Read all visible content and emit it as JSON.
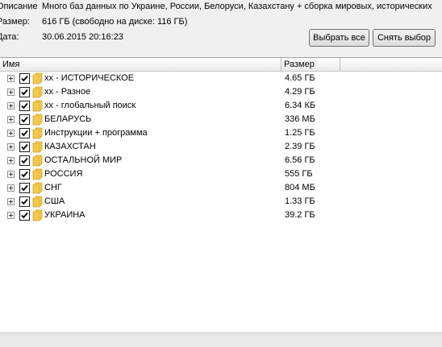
{
  "info": {
    "description_label": "Описание",
    "description_value": "Много баз данных по Украине, России, Белоруси, Казахстану + сборка мировых, исторических",
    "size_label": "Размер:",
    "size_value": "616 ГБ (свободно на диске: 116 ГБ)",
    "date_label": "Дата:",
    "date_value": "30.06.2015 20:16:23"
  },
  "buttons": {
    "select_all": "Выбрать все",
    "deselect": "Снять выбор"
  },
  "columns": {
    "name": "Имя",
    "size": "Размер"
  },
  "colors": {
    "folder": "#f2c94c",
    "check": "#000000"
  },
  "rows": [
    {
      "name": "хх - ИСТОРИЧЕСКОЕ",
      "size": "4.65 ГБ",
      "checked": true
    },
    {
      "name": "хх - Разное",
      "size": "4.29 ГБ",
      "checked": true
    },
    {
      "name": "хх - глобальный поиск",
      "size": "6.34 КБ",
      "checked": true
    },
    {
      "name": "БЕЛАРУСЬ",
      "size": "336 МБ",
      "checked": true
    },
    {
      "name": "Инструкции + программа",
      "size": "1.25 ГБ",
      "checked": true
    },
    {
      "name": "КАЗАХСТАН",
      "size": "2.39 ГБ",
      "checked": true
    },
    {
      "name": "ОСТАЛЬНОЙ МИР",
      "size": "6.56 ГБ",
      "checked": true
    },
    {
      "name": "РОССИЯ",
      "size": "555 ГБ",
      "checked": true
    },
    {
      "name": "СНГ",
      "size": "804 МБ",
      "checked": true
    },
    {
      "name": "США",
      "size": "1.33 ГБ",
      "checked": true
    },
    {
      "name": "УКРАИНА",
      "size": "39.2 ГБ",
      "checked": true
    }
  ]
}
